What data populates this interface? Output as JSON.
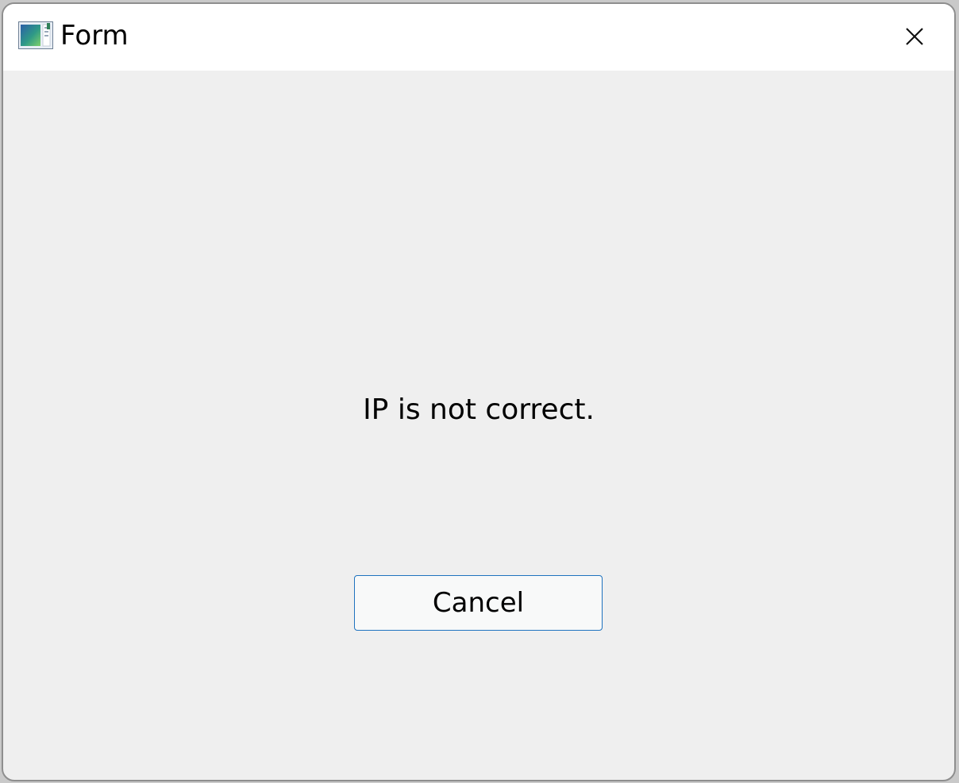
{
  "window": {
    "title": "Form",
    "icon": "form-app-icon",
    "close_icon": "close-icon"
  },
  "dialog": {
    "message": "IP is not correct.",
    "cancel_label": "Cancel"
  },
  "colors": {
    "titlebar_bg": "#ffffff",
    "window_bg": "#efefef",
    "button_border": "#1f73bf",
    "button_bg": "#f8f9f9"
  }
}
